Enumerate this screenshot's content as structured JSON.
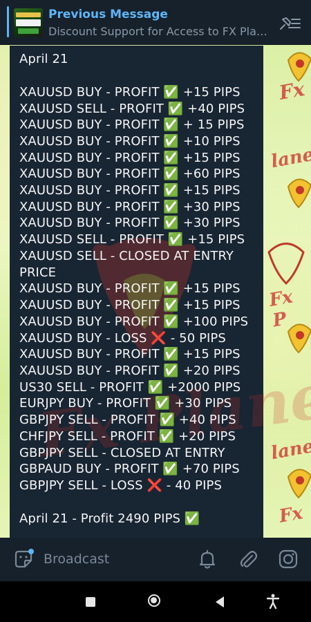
{
  "pinned": {
    "title": "Previous Message",
    "text": "Discount Support for Access to FX Plane..."
  },
  "message": {
    "date": "April 21",
    "lines": [
      "XAUUSD BUY - PROFIT ✅ +15 PIPS",
      "XAUUSD SELL - PROFIT ✅ +40 PIPS",
      "XAUUSD BUY - PROFIT ✅ + 15 PIPS",
      "XAUUSD BUY - PROFIT ✅ +10 PIPS",
      "XAUUSD BUY - PROFIT ✅ +15 PIPS",
      "XAUUSD BUY - PROFIT ✅ +60 PIPS",
      "XAUUSD BUY - PROFIT ✅ +15 PIPS",
      "XAUUSD BUY - PROFIT ✅ +30 PIPS",
      "XAUUSD BUY - PROFIT ✅ +30 PIPS",
      "XAUUSD SELL - PROFIT ✅ +15 PIPS",
      "XAUUSD SELL - CLOSED AT ENTRY",
      "PRICE",
      "XAUUSD BUY - PROFIT ✅ +15 PIPS",
      "XAUUSD BUY - PROFIT ✅ +15 PIPS",
      "XAUUSD BUY -  PROFIT ✅ +100 PIPS",
      "XAUUSD BUY -  LOSS ❌ - 50 PIPS",
      "XAUUSD BUY -  PROFIT ✅ +15 PIPS",
      "XAUUSD BUY -  PROFIT ✅ +20 PIPS",
      "US30 SELL -  PROFIT ✅ +2000 PIPS",
      "EURJPY BUY -  PROFIT ✅ +30 PIPS",
      "GBPJPY SELL -  PROFIT ✅ +40 PIPS",
      "CHFJPY SELL -  PROFIT ✅ +20 PIPS",
      "GBPJPY SELL -  CLOSED AT ENTRY",
      "GBPAUD BUY -  PROFIT ✅ +70 PIPS",
      "GBPJPY SELL - LOSS ❌ - 40 PIPS"
    ],
    "summary": "April 21 - Profit 2490 PIPS ✅"
  },
  "background": {
    "watermark_text": "Fx Planet",
    "watermark_fragments": [
      "Fx",
      "lanet",
      "Fx P",
      "Planet",
      "lanet",
      "Fx"
    ]
  },
  "input_bar": {
    "placeholder": "Broadcast"
  },
  "icons": {
    "pin": "pinned-list-icon",
    "sticker": "sticker-icon",
    "bell": "bell-icon",
    "attach": "paperclip-icon",
    "camera": "camera-icon",
    "nav_recents": "recents-square-icon",
    "nav_home": "home-circle-icon",
    "nav_back": "back-triangle-icon",
    "nav_accessibility": "accessibility-icon"
  },
  "colors": {
    "accent": "#5eb5f7",
    "header_bg": "#17212b",
    "bubble_bg": "#182533",
    "text": "#f5f5f5",
    "muted": "#8b98a5",
    "watermark": "#d2433d"
  }
}
